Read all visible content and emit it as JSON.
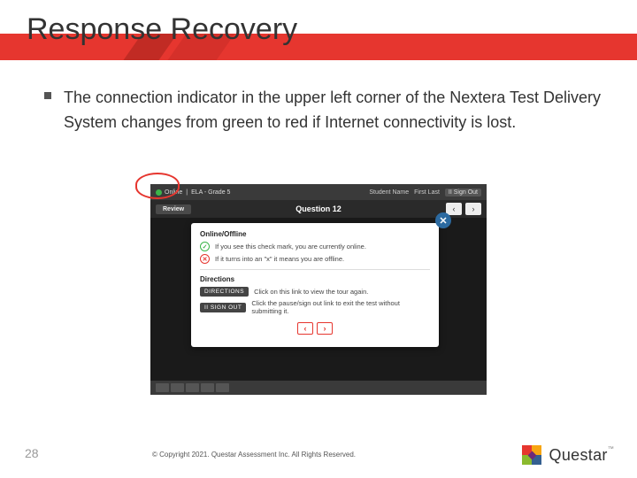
{
  "title": "Response Recovery",
  "bullet_text": "The connection indicator in the upper left corner of the Nextera Test Delivery System changes from green to red if Internet connectivity is lost.",
  "shot": {
    "status_word": "Online",
    "status_sep": "|",
    "breadcrumb": "ELA - Grade 5",
    "student_label": "Student Name",
    "student_name": "First Last",
    "signout": "II Sign Out",
    "review_tab": "Review",
    "question_label": "Question 12",
    "modal": {
      "h1": "Online/Offline",
      "line_ok": "If you see this check mark, you are currently online.",
      "line_no": "If it turns into an \"x\" it means you are offline.",
      "h2": "Directions",
      "btn_dir": "DIRECTIONS",
      "dir_text": "Click on this link to view the tour again.",
      "btn_pause": "II SIGN OUT",
      "pause_text": "Click the pause/sign out link to exit the test without submitting it."
    }
  },
  "footer": {
    "page": "28",
    "copyright": "© Copyright 2021. Questar Assessment Inc. All Rights Reserved.",
    "brand": "Questar",
    "tm": "™"
  }
}
